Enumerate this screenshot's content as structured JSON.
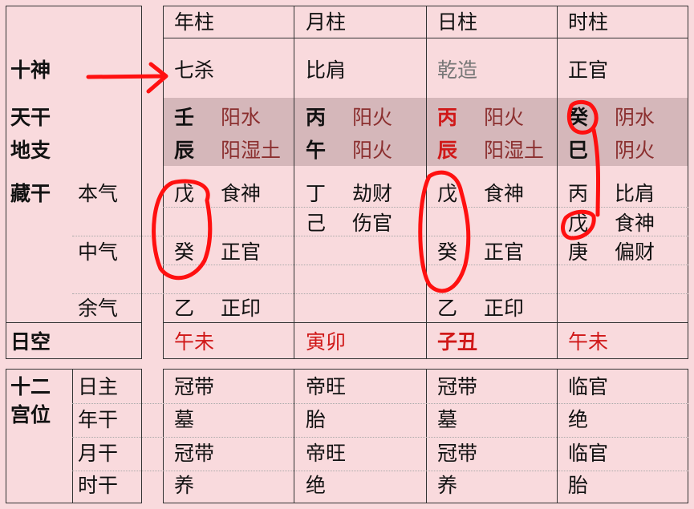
{
  "left_labels": {
    "shishen": "十神",
    "tiangan": "天干",
    "dizhi": "地支",
    "canggan": "藏干",
    "benqi": "本气",
    "zhongqi": "中气",
    "yuqi": "余气",
    "rikong": "日空"
  },
  "columns": [
    {
      "header": "年柱",
      "shishen": "七杀",
      "gan": "壬",
      "gan_el": "阳水",
      "zhi": "辰",
      "zhi_el": "阳湿土",
      "hidden": [
        {
          "stem": "戊",
          "god": "食神"
        },
        {
          "stem": "",
          "god": ""
        },
        {
          "stem": "癸",
          "god": "正官"
        },
        {
          "stem": "乙",
          "god": "正印"
        }
      ],
      "rikong": "午未"
    },
    {
      "header": "月柱",
      "shishen": "比肩",
      "gan": "丙",
      "gan_el": "阳火",
      "zhi": "午",
      "zhi_el": "阳火",
      "hidden": [
        {
          "stem": "丁",
          "god": "劫财"
        },
        {
          "stem": "己",
          "god": "伤官"
        },
        {
          "stem": "",
          "god": ""
        },
        {
          "stem": "",
          "god": ""
        }
      ],
      "rikong": "寅卯"
    },
    {
      "header": "日柱",
      "shishen": "乾造",
      "gan": "丙",
      "gan_el": "阳火",
      "zhi": "辰",
      "zhi_el": "阳湿土",
      "hidden": [
        {
          "stem": "戊",
          "god": "食神"
        },
        {
          "stem": "",
          "god": ""
        },
        {
          "stem": "癸",
          "god": "正官"
        },
        {
          "stem": "乙",
          "god": "正印"
        }
      ],
      "rikong": "子丑"
    },
    {
      "header": "时柱",
      "shishen": "正官",
      "gan": "癸",
      "gan_el": "阴水",
      "zhi": "巳",
      "zhi_el": "阴火",
      "hidden": [
        {
          "stem": "丙",
          "god": "比肩"
        },
        {
          "stem": "戊",
          "god": "食神"
        },
        {
          "stem": "庚",
          "god": "偏财"
        },
        {
          "stem": "",
          "god": ""
        }
      ],
      "rikong": "午未"
    }
  ],
  "palace": {
    "title_line1": "十二",
    "title_line2": "宫位",
    "rows": [
      "日主",
      "年干",
      "月干",
      "时干"
    ],
    "values": [
      [
        "冠带",
        "帝旺",
        "冠带",
        "临官"
      ],
      [
        "墓",
        "胎",
        "墓",
        "绝"
      ],
      [
        "冠带",
        "帝旺",
        "冠带",
        "临官"
      ],
      [
        "养",
        "绝",
        "养",
        "胎"
      ]
    ]
  },
  "colors": {
    "background": "#f9dadd",
    "band": "#d5b7ba",
    "element_text": "#8b2f2f",
    "highlight_red": "#d01818",
    "annotation": "#ff0000"
  }
}
